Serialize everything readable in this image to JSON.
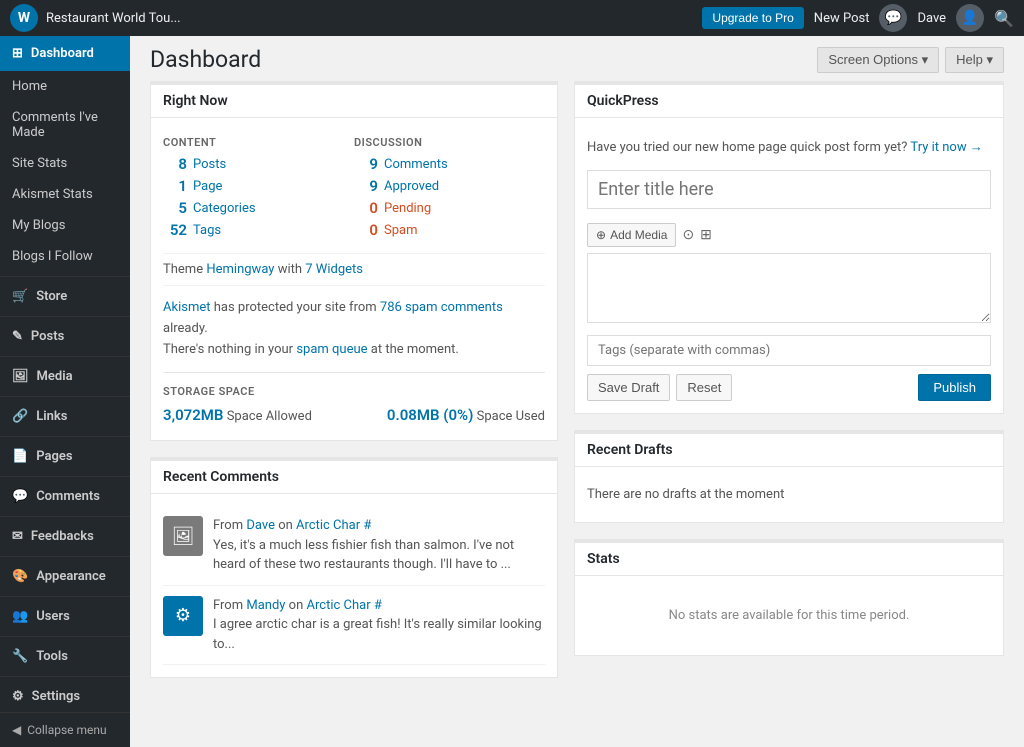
{
  "adminbar": {
    "logo_text": "W",
    "site_name": "Restaurant World Tou...",
    "upgrade_label": "Upgrade to Pro",
    "new_post_label": "New Post",
    "user_name": "Dave",
    "search_icon": "🔍",
    "message_icon": "💬"
  },
  "header": {
    "title": "Dashboard",
    "screen_options_label": "Screen Options ▾",
    "help_label": "Help ▾"
  },
  "sidebar": {
    "dashboard_label": "Dashboard",
    "home_label": "Home",
    "comments_label": "Comments I've Made",
    "site_stats_label": "Site Stats",
    "akismet_label": "Akismet Stats",
    "my_blogs_label": "My Blogs",
    "blogs_follow_label": "Blogs I Follow",
    "store_label": "Store",
    "posts_label": "Posts",
    "media_label": "Media",
    "links_label": "Links",
    "pages_label": "Pages",
    "comments_menu_label": "Comments",
    "feedbacks_label": "Feedbacks",
    "appearance_label": "Appearance",
    "users_label": "Users",
    "tools_label": "Tools",
    "settings_label": "Settings",
    "collapse_label": "Collapse menu"
  },
  "right_now": {
    "title": "Right Now",
    "content_header": "CONTENT",
    "discussion_header": "DISCUSSION",
    "items": [
      {
        "num": "8",
        "label": "Posts",
        "type": "content"
      },
      {
        "num": "1",
        "label": "Page",
        "type": "content"
      },
      {
        "num": "5",
        "label": "Categories",
        "type": "content"
      },
      {
        "num": "52",
        "label": "Tags",
        "type": "content"
      }
    ],
    "discussion_items": [
      {
        "num": "9",
        "label": "Comments",
        "type": "normal"
      },
      {
        "num": "9",
        "label": "Approved",
        "type": "normal"
      },
      {
        "num": "0",
        "label": "Pending",
        "type": "orange"
      },
      {
        "num": "0",
        "label": "Spam",
        "type": "orange"
      }
    ],
    "theme_text": "Theme",
    "theme_name": "Hemingway",
    "theme_with": "with",
    "theme_widgets": "7 Widgets",
    "akismet_text1": "Akismet",
    "akismet_text2": "has protected your site from",
    "akismet_link": "786 spam comments",
    "akismet_text3": "already.",
    "akismet_text4": "There's nothing in your",
    "akismet_queue": "spam queue",
    "akismet_text5": "at the moment.",
    "storage_label": "STORAGE SPACE",
    "storage_allowed_num": "3,072MB",
    "storage_allowed_text": "Space Allowed",
    "storage_used_num": "0.08MB (0%)",
    "storage_used_text": "Space Used"
  },
  "recent_comments": {
    "title": "Recent Comments",
    "items": [
      {
        "avatar": "🖼",
        "avatar_color": "gray",
        "from_text": "From",
        "author": "Dave",
        "on_text": "on",
        "post": "Arctic Char #",
        "text": "Yes, it's a much less fishier fish than salmon. I've not heard of these two restaurants though. I'll have to ..."
      },
      {
        "avatar": "⚙",
        "avatar_color": "blue",
        "from_text": "From",
        "author": "Mandy",
        "on_text": "on",
        "post": "Arctic Char #",
        "text": "I agree arctic char is a great fish! It's really similar looking to..."
      }
    ]
  },
  "quickpress": {
    "title": "QuickPress",
    "promo_text": "Have you tried our new home page quick post form yet?",
    "promo_link": "Try it now →",
    "title_placeholder": "Enter title here",
    "add_media_label": "Add Media",
    "body_placeholder": "",
    "tags_placeholder": "Tags (separate with commas)",
    "save_draft_label": "Save Draft",
    "reset_label": "Reset",
    "publish_label": "Publish"
  },
  "recent_drafts": {
    "title": "Recent Drafts",
    "no_drafts_text": "There are no drafts at the moment"
  },
  "stats": {
    "title": "Stats",
    "no_stats_text": "No stats are available for this time period."
  }
}
